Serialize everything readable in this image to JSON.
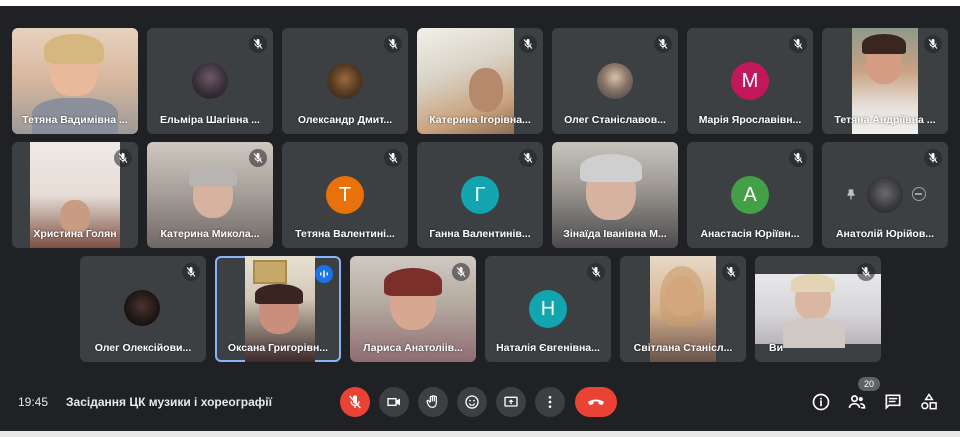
{
  "participants": [
    {
      "name": "Тетяна Вадимівна ...",
      "muted": false
    },
    {
      "name": "Ельміра Шагівна ...",
      "muted": true
    },
    {
      "name": "Олександр Дмит...",
      "muted": true
    },
    {
      "name": "Катерина Ігорівна...",
      "muted": true
    },
    {
      "name": "Олег Станіславов...",
      "muted": true
    },
    {
      "name": "Марія Ярославівн...",
      "muted": true,
      "initial": "М",
      "color": "#c2185b"
    },
    {
      "name": "Тетяна Андріївна ...",
      "muted": true
    },
    {
      "name": "Христина Голян",
      "muted": true
    },
    {
      "name": "Катерина Микола...",
      "muted": true
    },
    {
      "name": "Тетяна Валентинi...",
      "muted": true,
      "initial": "Т",
      "color": "#e8710a"
    },
    {
      "name": "Ганна Валентинів...",
      "muted": true,
      "initial": "Г",
      "color": "#12a4af"
    },
    {
      "name": "Зінаїда Іванівна М...",
      "muted": true
    },
    {
      "name": "Анастасія Юріївн...",
      "muted": true,
      "initial": "А",
      "color": "#43a047"
    },
    {
      "name": "Анатолій Юрійов...",
      "muted": true
    },
    {
      "name": "Олег Олексійови...",
      "muted": true
    },
    {
      "name": "Оксана Григорівн...",
      "muted": false,
      "speaking": true
    },
    {
      "name": "Лариса Анатоліів...",
      "muted": true
    },
    {
      "name": "Наталія Євгенівна...",
      "muted": true,
      "initial": "Н",
      "color": "#12a4af"
    },
    {
      "name": "Світлана Станісл...",
      "muted": true
    },
    {
      "name": "Ви",
      "muted": true
    }
  ],
  "bottom_bar": {
    "time": "19:45",
    "meeting_title": "Засідання ЦК музики і хореографії",
    "participant_count": "20"
  },
  "colors": {
    "background": "#202124",
    "tile": "#3c4043",
    "end_call": "#ea4335",
    "active_speaker": "#8ab4f8"
  },
  "icons": [
    "mic-off-icon",
    "camera-icon",
    "hand-raise-icon",
    "emoji-icon",
    "present-icon",
    "more-options-icon",
    "end-call-icon",
    "info-icon",
    "people-icon",
    "chat-icon",
    "activities-icon",
    "pin-icon",
    "speaking-icon"
  ]
}
